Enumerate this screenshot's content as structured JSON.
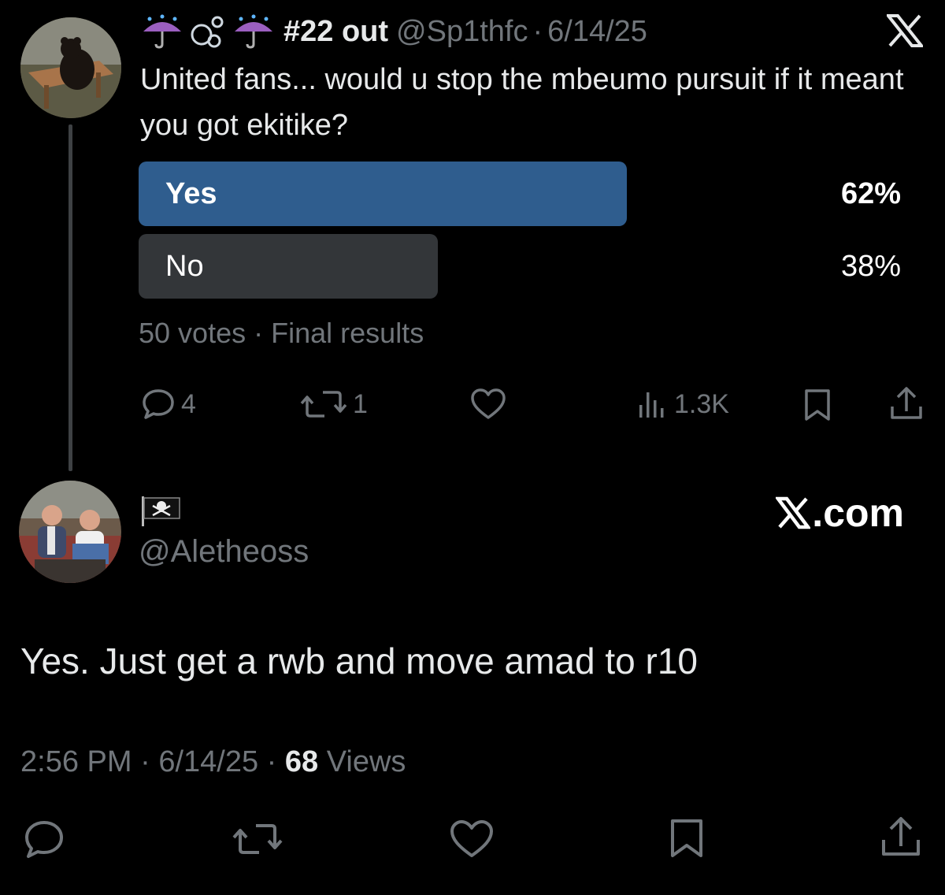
{
  "original_tweet": {
    "display_name": "#22 out",
    "handle": "@Sp1thfc",
    "separator": "·",
    "date": "6/14/25",
    "text": "United fans... would u stop the mbeumo pursuit if it meant you got ekitike?",
    "name_emoji_icons": [
      "umbrella-rain-icon",
      "bubbles-icon",
      "umbrella-rain-icon"
    ],
    "poll": {
      "options": [
        {
          "label": "Yes",
          "percent_text": "62%",
          "share": 0.62,
          "winner": true,
          "bar_color": "#2f5d8e"
        },
        {
          "label": "No",
          "percent_text": "38%",
          "share": 0.38,
          "winner": false,
          "bar_color": "#333639"
        }
      ],
      "votes": "50 votes",
      "separator": "·",
      "status": "Final results"
    },
    "actions": {
      "replies": "4",
      "reposts": "1",
      "likes": "",
      "views": "1.3K"
    }
  },
  "reply": {
    "flag_icon": "pirate-flag-icon",
    "handle": "@Aletheoss",
    "text": "Yes. Just get a rwb and move amad to r10",
    "time": "2:56 PM",
    "separator": "·",
    "date": "6/14/25",
    "views_count": "68",
    "views_label": "Views"
  },
  "watermark": {
    "text": ".com",
    "icon": "x-logo-icon"
  },
  "colors": {
    "background": "#000000",
    "text_primary": "#e7e9ea",
    "text_secondary": "#71767b",
    "poll_winner": "#2f5d8e",
    "poll_other": "#333639"
  }
}
